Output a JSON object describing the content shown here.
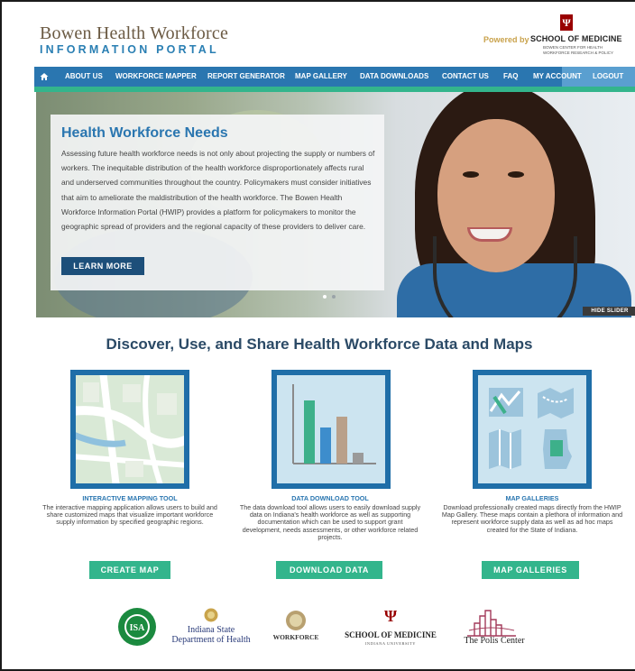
{
  "header": {
    "brand_line1": "Bowen Health Workforce",
    "brand_line2": "INFORMATION PORTAL",
    "powered_by": "Powered by",
    "school_name": "SCHOOL OF MEDICINE",
    "school_sub": "BOWEN CENTER FOR HEALTH WORKFORCE RESEARCH & POLICY"
  },
  "nav": {
    "items": [
      "ABOUT US",
      "WORKFORCE MAPPER",
      "REPORT GENERATOR",
      "MAP GALLERY",
      "DATA DOWNLOADS",
      "CONTACT US",
      "FAQ",
      "MY ACCOUNT",
      "LOGOUT"
    ]
  },
  "hero": {
    "title": "Health Workforce Needs",
    "text": "Assessing future health workforce needs is not only about projecting the supply or numbers of workers. The inequitable distribution of the health workforce disproportionately affects rural and underserved communities throughout the country. Policymakers must consider initiatives that aim to ameliorate the maldistribution of the health workforce. The Bowen Health Workforce Information Portal (HWIP) provides a platform for policymakers to monitor the geographic spread of providers and the regional capacity of these providers to deliver care.",
    "button": "LEARN MORE",
    "hide_slider": "HIDE SLIDER"
  },
  "main": {
    "title": "Discover, Use, and Share Health Workforce Data and Maps",
    "tools": [
      {
        "heading": "INTERACTIVE MAPPING TOOL",
        "description": "The interactive mapping application allows users to build and share customized maps that visualize important workforce supply information by specified geographic regions.",
        "button": "CREATE MAP"
      },
      {
        "heading": "DATA DOWNLOAD TOOL",
        "description": "The data download tool allows users to easily download supply data on Indiana's health workforce as well as supporting documentation which can be used to support grant development, needs assessments, or other workforce related projects.",
        "button": "DOWNLOAD DATA"
      },
      {
        "heading": "MAP GALLERIES",
        "description": "Download professionally created maps directly from the HWIP Map Gallery. These maps contain a plethora of information and represent workforce supply data as well as ad hoc maps created for the State of Indiana.",
        "button": "MAP GALLERIES"
      }
    ]
  },
  "partners": {
    "isdh_line1": "Indiana State",
    "isdh_line2": "Department of Health",
    "workforce": "WORKFORCE",
    "som": "SCHOOL OF MEDICINE",
    "som_sub": "INDIANA UNIVERSITY",
    "polis": "The Polis Center"
  },
  "colors": {
    "nav_blue": "#2a76b0",
    "accent_green": "#33b58c",
    "dark_blue": "#1d4f7a",
    "iu_crimson": "#990000"
  }
}
